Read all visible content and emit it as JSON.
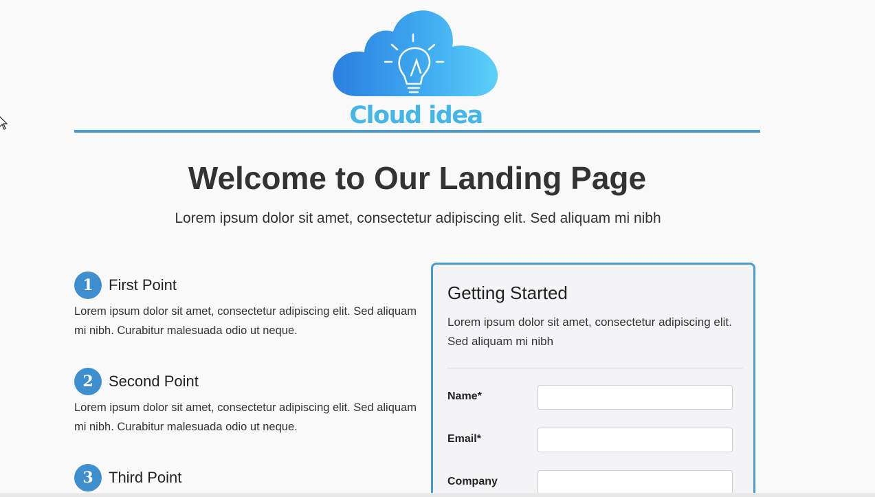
{
  "brand": {
    "name": "Cloud idea",
    "color": "#44b6e8"
  },
  "hero": {
    "title": "Welcome to Our Landing Page",
    "subtitle": "Lorem ipsum dolor sit amet, consectetur adipiscing elit. Sed aliquam mi nibh"
  },
  "points": [
    {
      "number": "1",
      "title": "First Point",
      "body": "Lorem ipsum dolor sit amet, consectetur adipiscing elit. Sed aliquam mi nibh. Curabitur malesuada odio ut neque."
    },
    {
      "number": "2",
      "title": "Second Point",
      "body": "Lorem ipsum dolor sit amet, consectetur adipiscing elit. Sed aliquam mi nibh. Curabitur malesuada odio ut neque."
    },
    {
      "number": "3",
      "title": "Third Point",
      "body": ""
    }
  ],
  "form": {
    "title": "Getting Started",
    "description": "Lorem ipsum dolor sit amet, consectetur adipiscing elit. Sed aliquam mi nibh",
    "fields": [
      {
        "label": "Name*",
        "value": ""
      },
      {
        "label": "Email*",
        "value": ""
      },
      {
        "label": "Company",
        "value": ""
      }
    ]
  },
  "colors": {
    "accent": "#4a9bd2",
    "badge": "#3d8fcf",
    "background": "#f9f9fa"
  }
}
